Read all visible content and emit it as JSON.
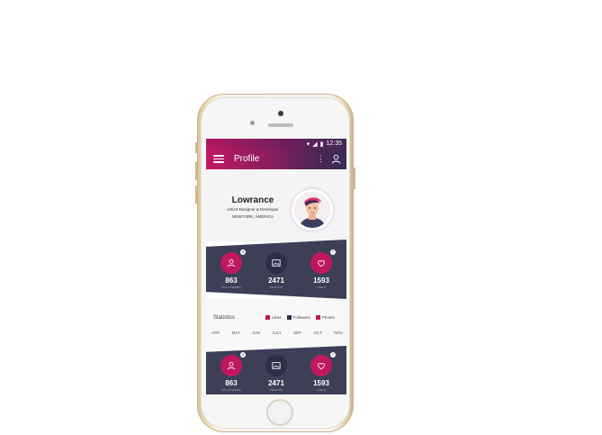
{
  "status": {
    "time": "12:35"
  },
  "appbar": {
    "title": "Profile"
  },
  "profile": {
    "name": "Lowrance",
    "role": "UI/UX Designer & Developer",
    "location": "NEWYORK, AMERICA"
  },
  "stats_top": [
    {
      "value": "863",
      "label": "FOLLOWERS",
      "badge": "4",
      "icon": "user-icon",
      "style": "pink"
    },
    {
      "value": "2471",
      "label": "PHOTOS",
      "badge": "",
      "icon": "image-icon",
      "style": "dark"
    },
    {
      "value": "1593",
      "label": "LIKES",
      "badge": "7",
      "icon": "heart-icon",
      "style": "pink"
    }
  ],
  "statistics": {
    "title": "Statistics",
    "legend": [
      {
        "label": "Likes",
        "color": "#c0185e"
      },
      {
        "label": "Followers",
        "color": "#2d2f4a"
      },
      {
        "label": "Photos",
        "color": "#c0185e"
      }
    ],
    "months": [
      "APR",
      "MAY",
      "JUN",
      "JULY",
      "SEP",
      "OCT",
      "NOV"
    ]
  },
  "stats_bottom": [
    {
      "value": "863",
      "label": "FOLLOWERS",
      "badge": "4",
      "icon": "user-icon",
      "style": "pink"
    },
    {
      "value": "2471",
      "label": "PHOTOS",
      "badge": "",
      "icon": "image-icon",
      "style": "dark"
    },
    {
      "value": "1593",
      "label": "LIKES",
      "badge": "7",
      "icon": "heart-icon",
      "style": "pink"
    }
  ],
  "colors": {
    "accent": "#c0185e",
    "dark": "#3c3f56"
  }
}
